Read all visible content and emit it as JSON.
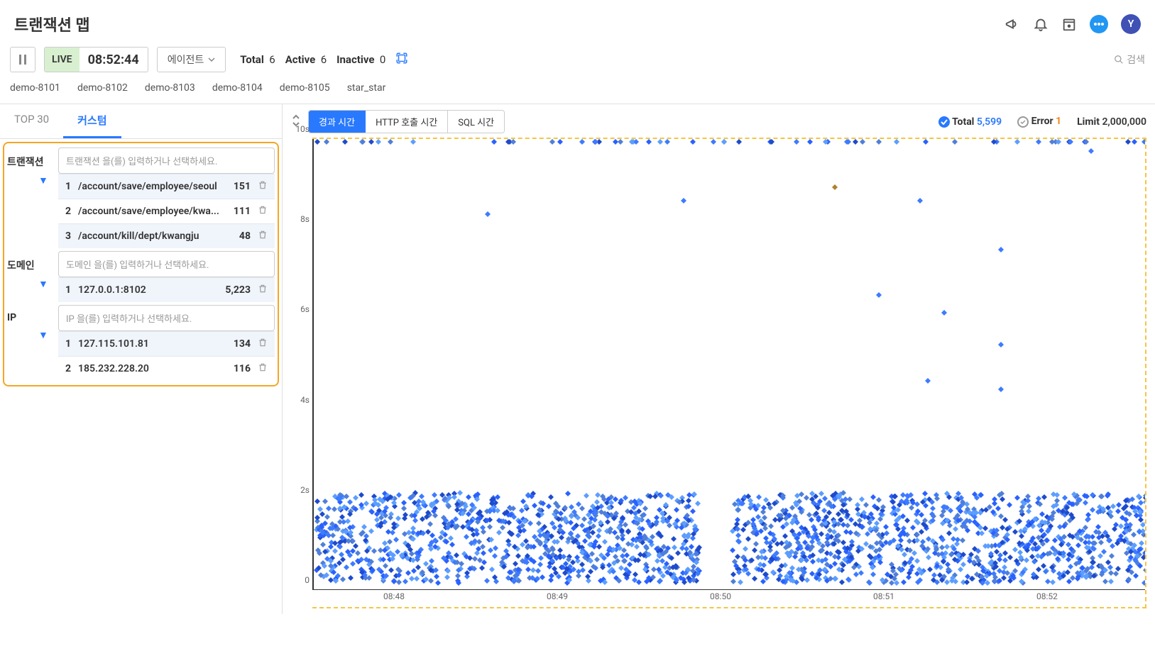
{
  "header": {
    "title": "트랜잭션 맵",
    "avatar": "Y"
  },
  "toolbar": {
    "live_label": "LIVE",
    "time": "08:52:44",
    "agent_label": "에이전트",
    "total_label": "Total",
    "total_value": "6",
    "active_label": "Active",
    "active_value": "6",
    "inactive_label": "Inactive",
    "inactive_value": "0",
    "search_label": "검색"
  },
  "agents": [
    "demo-8101",
    "demo-8102",
    "demo-8103",
    "demo-8104",
    "demo-8105",
    "star_star"
  ],
  "side_tabs": {
    "top": "TOP 30",
    "custom": "커스텀"
  },
  "filters": {
    "tx_label": "트랜잭션",
    "tx_placeholder": "트랜잭션 을(를) 입력하거나 선택하세요.",
    "tx_rows": [
      {
        "idx": "1",
        "path": "/account/save/employee/seoul",
        "cnt": "151"
      },
      {
        "idx": "2",
        "path": "/account/save/employee/kwa...",
        "cnt": "111"
      },
      {
        "idx": "3",
        "path": "/account/kill/dept/kwangju",
        "cnt": "48"
      }
    ],
    "domain_label": "도메인",
    "domain_placeholder": "도메인 을(를) 입력하거나 선택하세요.",
    "domain_rows": [
      {
        "idx": "1",
        "path": "127.0.0.1:8102",
        "cnt": "5,223"
      }
    ],
    "ip_label": "IP",
    "ip_placeholder": "IP 을(를) 입력하거나 선택하세요.",
    "ip_rows": [
      {
        "idx": "1",
        "path": "127.115.101.81",
        "cnt": "134"
      },
      {
        "idx": "2",
        "path": "185.232.228.20",
        "cnt": "116"
      }
    ]
  },
  "chart_tabs": {
    "elapsed": "경과 시간",
    "http": "HTTP 호출 시간",
    "sql": "SQL 시간"
  },
  "chart_stats": {
    "total_label": "Total",
    "total_value": "5,599",
    "error_label": "Error",
    "error_value": "1",
    "limit_label": "Limit",
    "limit_value": "2,000,000"
  },
  "chart_data": {
    "type": "scatter",
    "title": "",
    "xlabel": "",
    "ylabel": "",
    "x_ticks": [
      "08:48",
      "08:49",
      "08:50",
      "08:51",
      "08:52"
    ],
    "y_ticks": [
      "0",
      "2s",
      "4s",
      "6s",
      "8s",
      "10s"
    ],
    "ylim": [
      0,
      10
    ],
    "x_domain_minutes": [
      47.5,
      52.6
    ],
    "dense_band": {
      "y_min": 0.2,
      "y_max": 2.2,
      "gap_x": [
        49.85,
        50.05
      ],
      "approx_count": 5500
    },
    "top_band_y": 10.0,
    "top_band_approx_count": 60,
    "outliers": [
      {
        "x": 48.55,
        "y": 8.4
      },
      {
        "x": 49.75,
        "y": 8.7
      },
      {
        "x": 50.95,
        "y": 6.6
      },
      {
        "x": 51.2,
        "y": 8.7
      },
      {
        "x": 51.25,
        "y": 4.7
      },
      {
        "x": 51.35,
        "y": 6.2
      },
      {
        "x": 51.7,
        "y": 7.6
      },
      {
        "x": 51.7,
        "y": 5.5
      },
      {
        "x": 51.7,
        "y": 4.5
      },
      {
        "x": 52.25,
        "y": 9.8
      },
      {
        "x": 50.68,
        "y": 9.0,
        "error": true
      }
    ]
  }
}
